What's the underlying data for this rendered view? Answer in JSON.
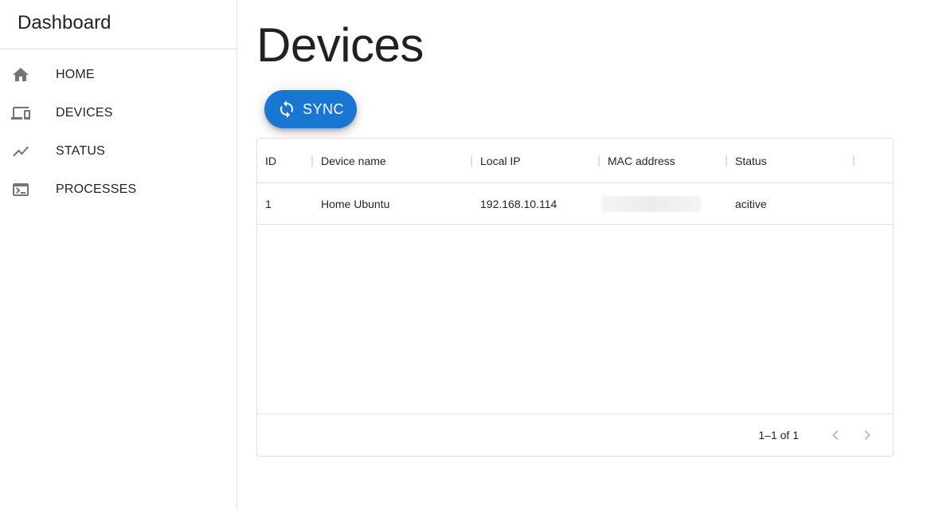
{
  "sidebar": {
    "title": "Dashboard",
    "items": [
      {
        "label": "HOME",
        "icon": "home-icon"
      },
      {
        "label": "DEVICES",
        "icon": "devices-icon"
      },
      {
        "label": "STATUS",
        "icon": "trending-icon"
      },
      {
        "label": "PROCESSES",
        "icon": "terminal-icon"
      }
    ]
  },
  "main": {
    "title": "Devices",
    "sync_label": "SYNC",
    "table": {
      "columns": [
        "ID",
        "Device name",
        "Local IP",
        "MAC address",
        "Status"
      ],
      "rows": [
        {
          "id": "1",
          "device_name": "Home Ubuntu",
          "local_ip": "192.168.10.114",
          "mac_address": "[redacted]",
          "status": "acitive"
        }
      ],
      "pagination": "1–1 of 1"
    }
  },
  "colors": {
    "accent": "#1976d2",
    "icon": "#757575",
    "divider": "#e0e0e0"
  }
}
